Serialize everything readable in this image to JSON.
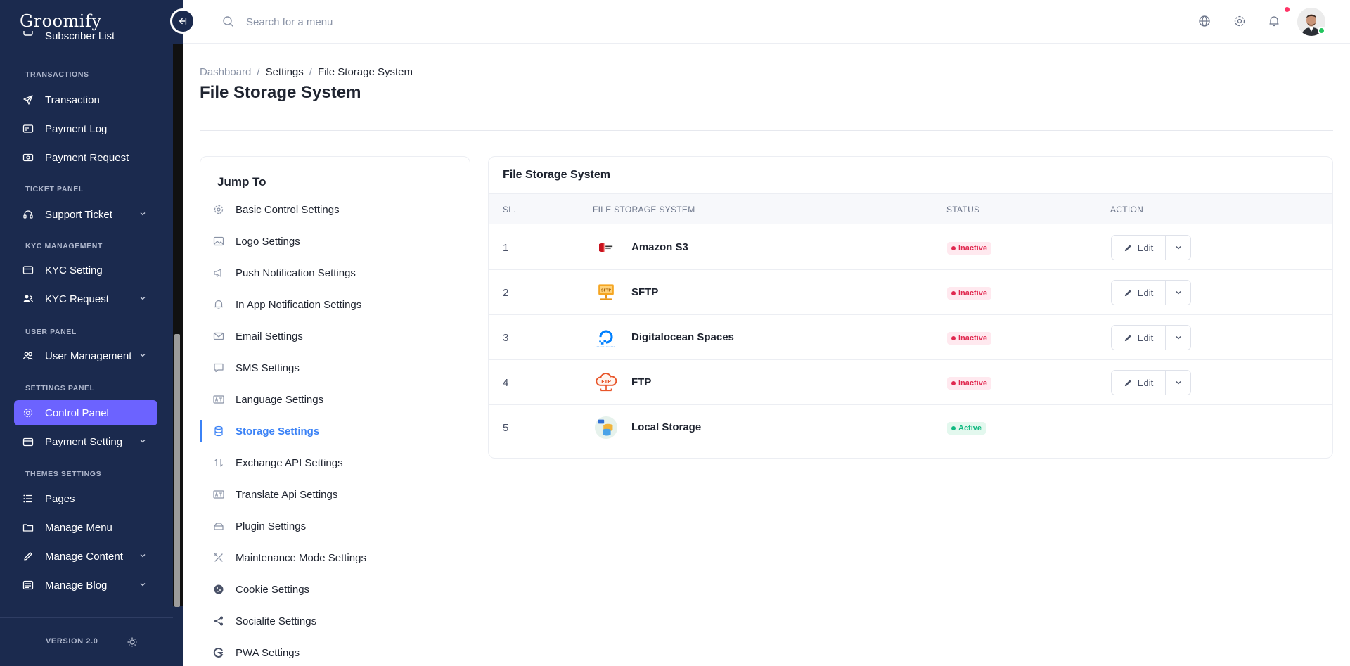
{
  "app": {
    "logo": "Groomify",
    "version": "VERSION 2.0"
  },
  "sidebar": {
    "items": [
      {
        "label": "Subscriber List"
      },
      {
        "section": "TRANSACTIONS"
      },
      {
        "label": "Transaction",
        "icon": "send-icon"
      },
      {
        "label": "Payment Log",
        "icon": "receipt-icon"
      },
      {
        "label": "Payment Request",
        "icon": "cash-icon"
      },
      {
        "section": "TICKET PANEL"
      },
      {
        "label": "Support Ticket",
        "icon": "headset-icon"
      },
      {
        "section": "KYC MANAGEMENT"
      },
      {
        "label": "KYC Setting",
        "icon": "id-card-icon"
      },
      {
        "label": "KYC Request",
        "icon": "user-group-icon"
      },
      {
        "section": "USER PANEL"
      },
      {
        "label": "User Management",
        "icon": "users-icon"
      },
      {
        "section": "SETTINGS PANEL"
      },
      {
        "label": "Control Panel",
        "icon": "gear-icon"
      },
      {
        "label": "Payment Setting",
        "icon": "wallet-icon"
      },
      {
        "section": "THEMES SETTINGS"
      },
      {
        "label": "Pages",
        "icon": "list-icon"
      },
      {
        "label": "Manage Menu",
        "icon": "folder-icon"
      },
      {
        "label": "Manage Content",
        "icon": "pencil-icon"
      },
      {
        "label": "Manage Blog",
        "icon": "blog-icon"
      }
    ]
  },
  "topbar": {
    "search_placeholder": "Search for a menu"
  },
  "breadcrumb": [
    "Dashboard",
    "Settings",
    "File Storage System"
  ],
  "page_title": "File Storage System",
  "jump": {
    "title": "Jump To",
    "items": [
      "Basic Control Settings",
      "Logo Settings",
      "Push Notification Settings",
      "In App Notification Settings",
      "Email Settings",
      "SMS Settings",
      "Language Settings",
      "Storage Settings",
      "Exchange API Settings",
      "Translate Api Settings",
      "Plugin Settings",
      "Maintenance Mode Settings",
      "Cookie Settings",
      "Socialite Settings",
      "PWA Settings"
    ],
    "active_item": "Storage Settings"
  },
  "storage": {
    "title": "File Storage System",
    "columns": [
      "SL.",
      "FILE STORAGE SYSTEM",
      "STATUS",
      "ACTION"
    ],
    "edit_label": "Edit",
    "rows": [
      {
        "sl": "1",
        "name": "Amazon S3",
        "status": "Inactive"
      },
      {
        "sl": "2",
        "name": "SFTP",
        "status": "Inactive"
      },
      {
        "sl": "3",
        "name": "Digitalocean Spaces",
        "status": "Inactive"
      },
      {
        "sl": "4",
        "name": "FTP",
        "status": "Inactive"
      },
      {
        "sl": "5",
        "name": "Local Storage",
        "status": "Active"
      }
    ]
  },
  "colors": {
    "sidebar_bg": "#1b2a4e",
    "accent": "#6c63ff",
    "link_blue": "#3b82f6",
    "inactive": "#e0284f",
    "active": "#10b981"
  }
}
